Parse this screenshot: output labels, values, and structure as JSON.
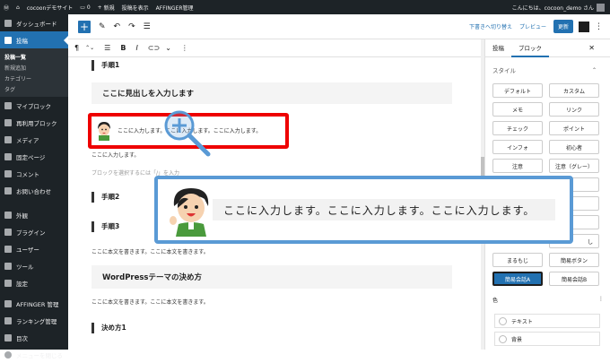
{
  "adminbar": {
    "site": "cocoonデモサイト",
    "comments_count": "0",
    "new": "新規",
    "view_post": "投稿を表示",
    "affinger": "AFFINGER管理",
    "greeting": "こんにちは、cocoon_demo さん"
  },
  "sidebar": {
    "dashboard": "ダッシュボード",
    "posts": "投稿",
    "sub": [
      "投稿一覧",
      "新規追加",
      "カテゴリー",
      "タグ"
    ],
    "myblock": "マイブロック",
    "reusable": "再利用ブロック",
    "media": "メディア",
    "pages": "固定ページ",
    "comments": "コメント",
    "contact": "お問い合わせ",
    "appearance": "外観",
    "plugins": "プラグイン",
    "users": "ユーザー",
    "tools": "ツール",
    "settings": "設定",
    "affinger": "AFFINGER 管理",
    "ranking": "ランキング管理",
    "toc": "目次",
    "collapse": "メニューを閉じる"
  },
  "toolbar": {
    "save_draft": "下書きへ切り替え",
    "preview": "プレビュー",
    "update": "更新"
  },
  "editor": {
    "step1": "手順1",
    "heading_placeholder": "ここに見出しを入力します",
    "bubble_text": "ここに入力します。ここに入力します。ここに入力します。",
    "line_text": "ここに入力します。",
    "block_hint": "ブロックを選択するには「/」を入力",
    "step2": "手順2",
    "step3": "手順3",
    "body1": "ここに本文を書きます。ここに本文を書きます。",
    "heading_theme": "WordPressテーマの決め方",
    "body2": "ここに本文を書きます。ここに本文を書きます。",
    "howto": "決め方1"
  },
  "callout": {
    "text": "ここに入力します。ここに入力します。ここに入力します。"
  },
  "settings": {
    "tab_post": "投稿",
    "tab_block": "ブロック",
    "style_label": "スタイル",
    "styles": [
      "デフォルト",
      "カスタム",
      "メモ",
      "リンク",
      "チェック",
      "ポイント",
      "インフォ",
      "初心者",
      "注意",
      "注意（グレー）",
      "まるもじ",
      "簡易ボタン",
      "簡易会話A",
      "簡易会話B"
    ],
    "selected_style": "簡易会話A",
    "color_label": "色",
    "color_items": [
      "テキスト",
      "背景"
    ],
    "partial_label": "し"
  },
  "colors": {
    "accent": "#2271b1",
    "admin_dark": "#1d2327",
    "highlight_red": "#e00000",
    "callout_blue": "#5a9ad5"
  }
}
